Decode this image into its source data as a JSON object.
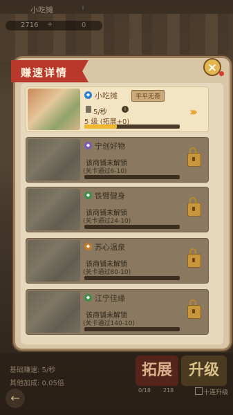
{
  "hud": {
    "stall_title": "小吃摊",
    "coins": "2716",
    "plus": "+",
    "gems": "0"
  },
  "panel": {
    "title": "赚速详情",
    "close_label": "×"
  },
  "shops": [
    {
      "name": "小吃摊",
      "tag": "平平无奇",
      "rate": "5/秒",
      "level": "5 级 (拓展+0)",
      "progress": 0.34,
      "state": "unlocked",
      "icon": "bag-icon",
      "icon_color": "#2a7ed6"
    },
    {
      "name": "宁创好物",
      "status": "该商铺未解锁",
      "condition": "(关卡通过6-10)",
      "state": "locked",
      "icon": "gift-icon",
      "icon_color": "#7a5ab5"
    },
    {
      "name": "铁臂健身",
      "status": "该商铺未解锁",
      "condition": "(关卡通过24-10)",
      "state": "locked",
      "icon": "dumbbell-icon",
      "icon_color": "#3e8f4a"
    },
    {
      "name": "苏心温泉",
      "status": "该商铺未解锁",
      "condition": "(关卡通过80-10)",
      "state": "locked",
      "icon": "spring-icon",
      "icon_color": "#c47c2a"
    },
    {
      "name": "江宁佳缘",
      "status": "该商铺未解锁",
      "condition": "(关卡通过140-10)",
      "state": "locked",
      "icon": "heart-icon",
      "icon_color": "#3e8f4a"
    }
  ],
  "bottom": {
    "base_rate": "基础赚速: 5/秒",
    "extra_bonus": "其他加成: 0.05倍",
    "expand_label": "拓展",
    "upgrade_label": "升级",
    "cost_expand": "0/18",
    "cost_upgrade": "218",
    "ten_upgrade": "十连升级",
    "back": "←"
  }
}
